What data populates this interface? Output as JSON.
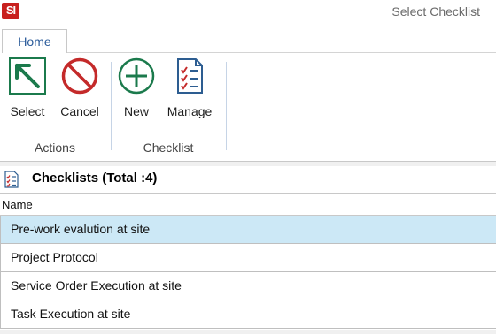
{
  "app": {
    "logo_text": "SI",
    "window_title": "Select Checklist"
  },
  "tabs": [
    {
      "label": "Home"
    }
  ],
  "ribbon": {
    "buttons": {
      "select": {
        "label": "Select",
        "icon": "select-arrow-icon"
      },
      "cancel": {
        "label": "Cancel",
        "icon": "cancel-circle-icon"
      },
      "new": {
        "label": "New",
        "icon": "plus-circle-icon"
      },
      "manage": {
        "label": "Manage",
        "icon": "checklist-document-icon"
      }
    },
    "groups": {
      "actions": "Actions",
      "checklist": "Checklist"
    }
  },
  "list": {
    "title": "Checklists (Total :4)",
    "column_header": "Name",
    "rows": [
      {
        "name": "Pre-work evalution at site"
      },
      {
        "name": "Project Protocol"
      },
      {
        "name": "Service Order Execution at site"
      },
      {
        "name": "Task Execution at site"
      }
    ],
    "selected_index": 0
  },
  "colors": {
    "accent_green": "#1b7a4c",
    "cancel_red": "#c42a2a",
    "selection": "#cce8f6",
    "tab_text": "#2a5b9a"
  }
}
